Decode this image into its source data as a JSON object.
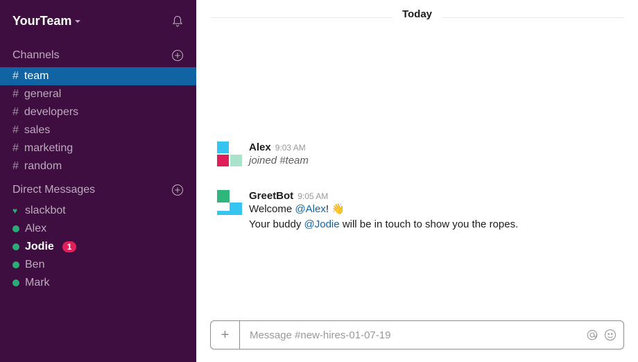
{
  "sidebar": {
    "team_name": "YourTeam",
    "channels_header": "Channels",
    "dm_header": "Direct Messages",
    "channels": [
      {
        "name": "team",
        "active": true
      },
      {
        "name": "general",
        "active": false
      },
      {
        "name": "developers",
        "active": false
      },
      {
        "name": "sales",
        "active": false
      },
      {
        "name": "marketing",
        "active": false
      },
      {
        "name": "random",
        "active": false
      }
    ],
    "dms": [
      {
        "name": "slackbot",
        "presence": "heart",
        "unread": false,
        "badge": null
      },
      {
        "name": "Alex",
        "presence": "online",
        "unread": false,
        "badge": null
      },
      {
        "name": "Jodie",
        "presence": "online",
        "unread": true,
        "badge": "1"
      },
      {
        "name": "Ben",
        "presence": "online",
        "unread": false,
        "badge": null
      },
      {
        "name": "Mark",
        "presence": "online",
        "unread": false,
        "badge": null
      }
    ]
  },
  "main": {
    "date_label": "Today",
    "messages": [
      {
        "sender": "Alex",
        "time": "9:03 AM",
        "body_plain": "joined #team",
        "system": true
      },
      {
        "sender": "GreetBot",
        "time": "9:05 AM",
        "line1_pre": "Welcome ",
        "line1_mention": "@Alex",
        "line1_post": "! ",
        "line1_emoji": "👋",
        "line2_pre": "Your buddy ",
        "line2_mention": "@Jodie",
        "line2_post": " will be in touch to show you the ropes."
      }
    ],
    "composer_placeholder": "Message #new-hires-01-07-19"
  }
}
